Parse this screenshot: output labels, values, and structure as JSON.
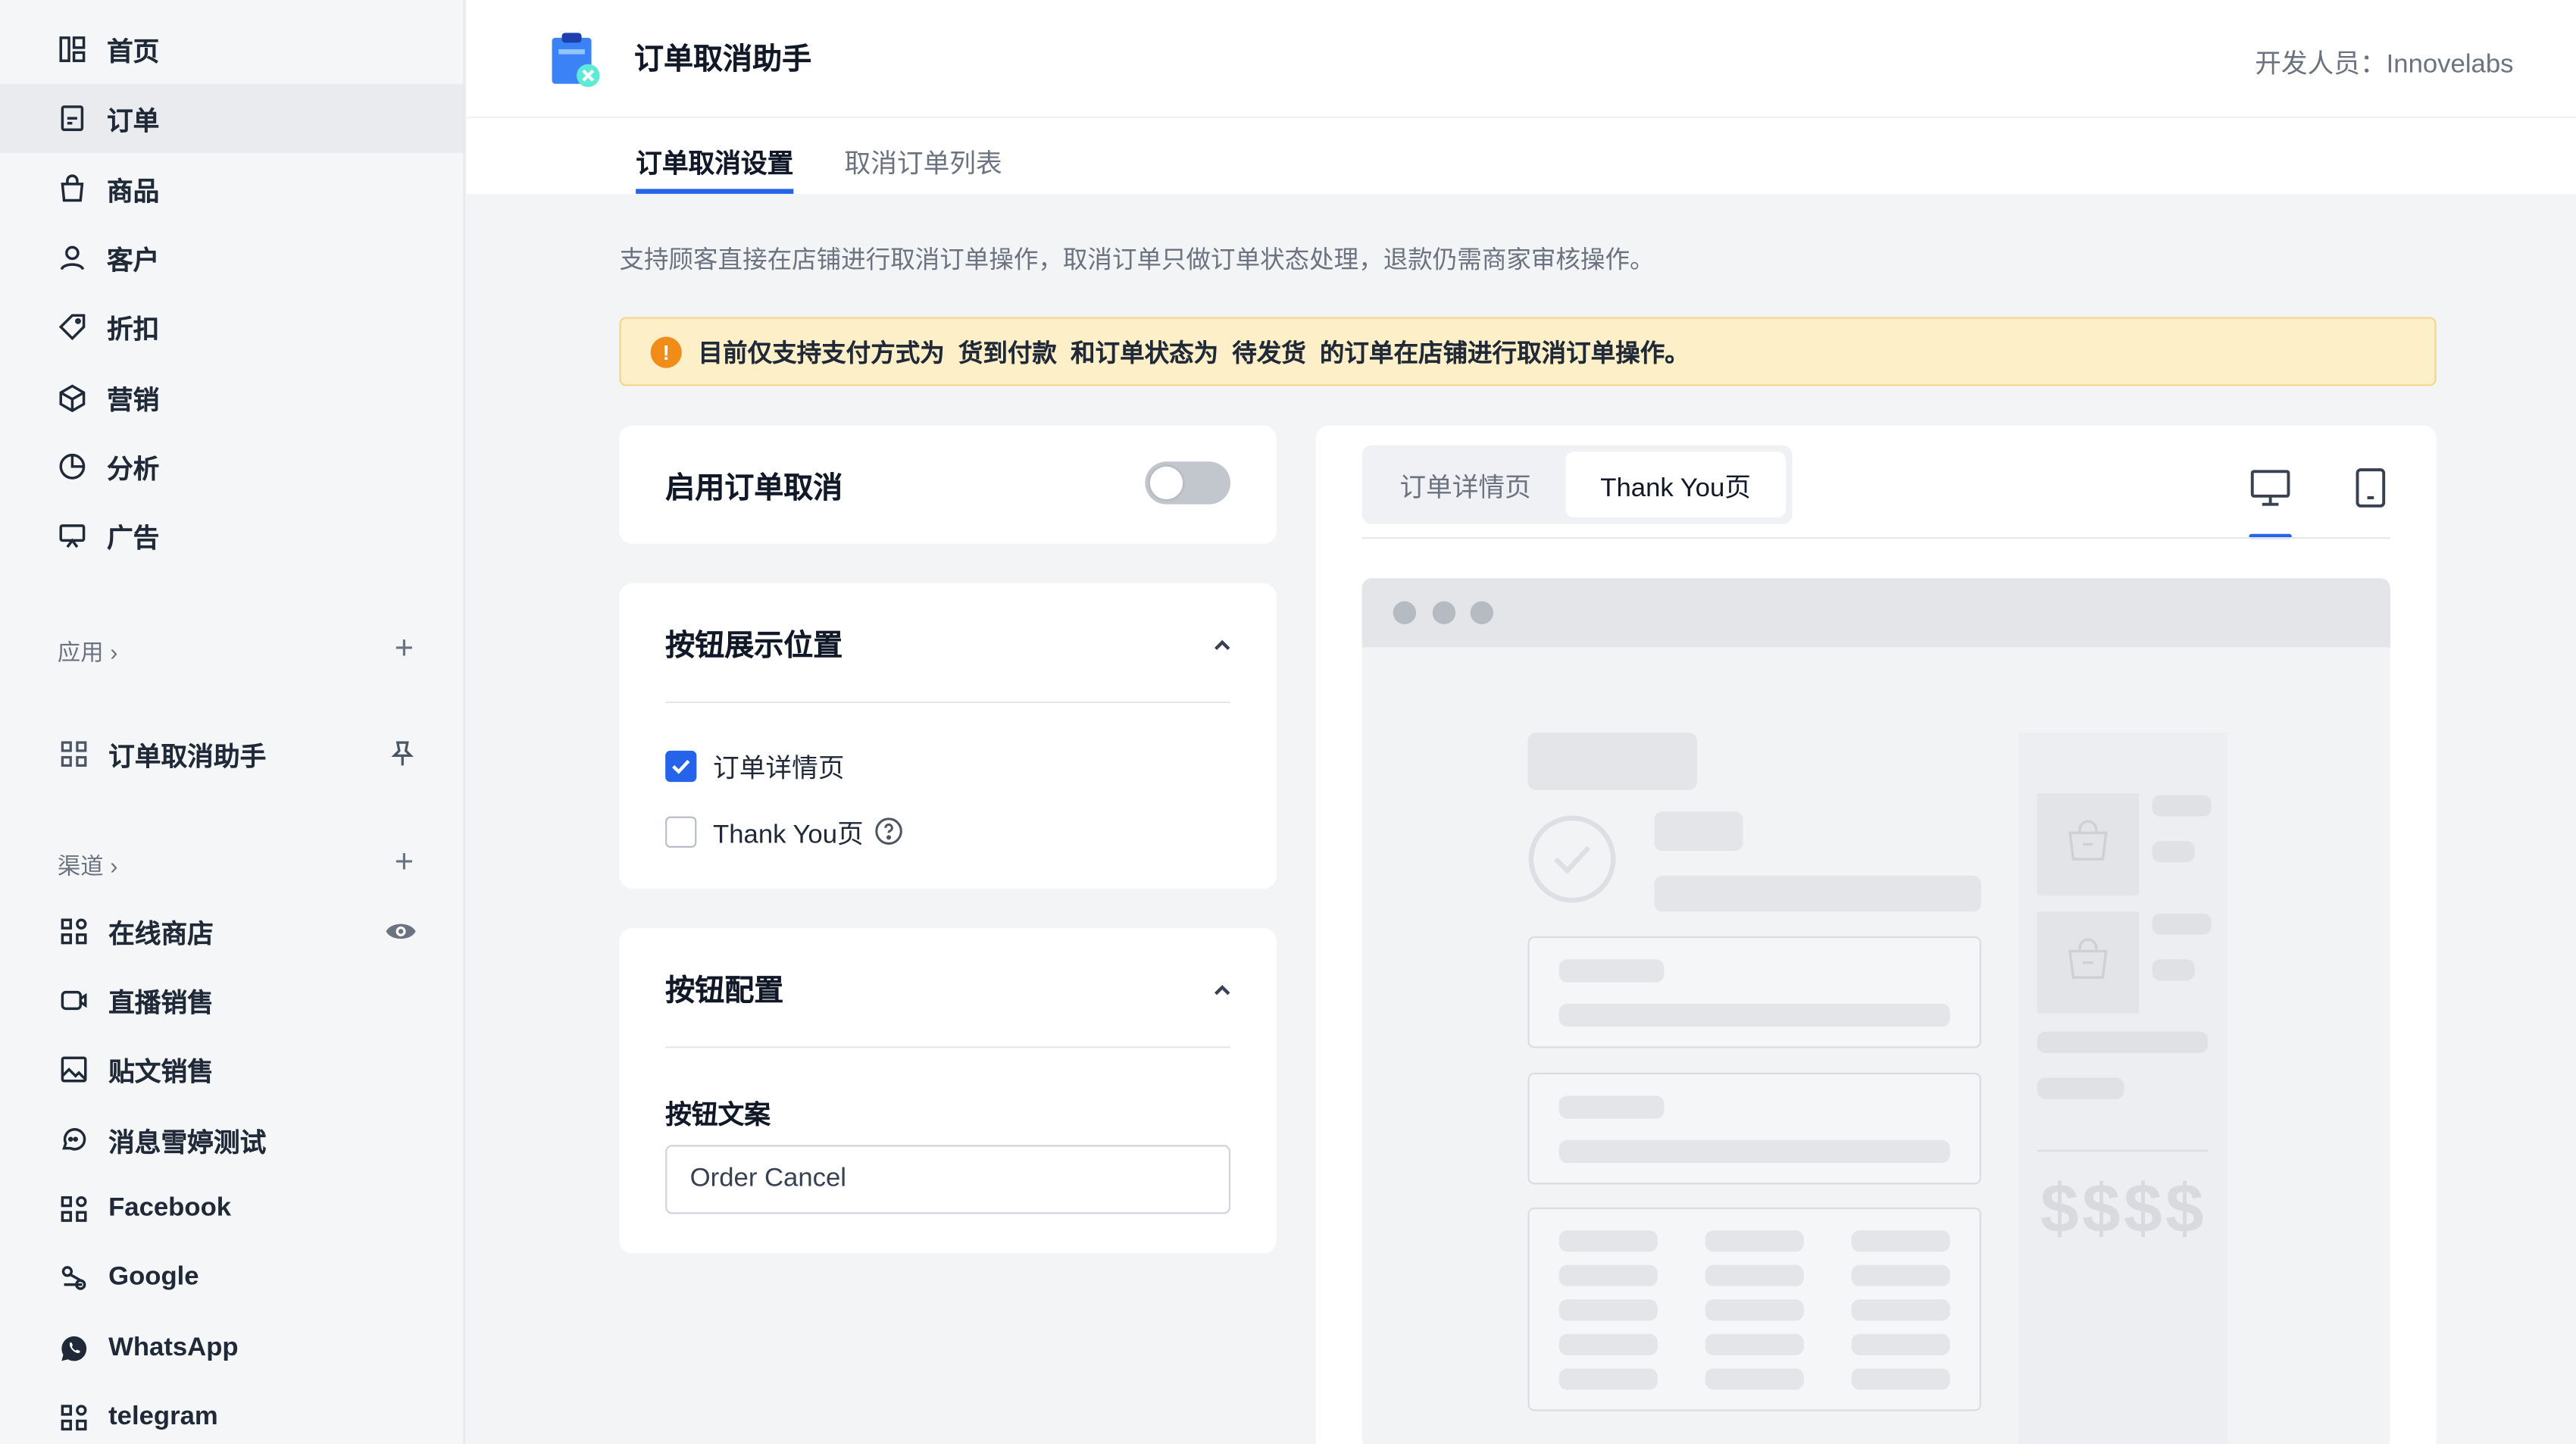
{
  "sidebar": {
    "nav": [
      {
        "label": "首页",
        "icon": "dashboard-icon"
      },
      {
        "label": "订单",
        "icon": "order-icon",
        "active": true
      },
      {
        "label": "商品",
        "icon": "bag-icon"
      },
      {
        "label": "客户",
        "icon": "user-icon"
      },
      {
        "label": "折扣",
        "icon": "tag-icon"
      },
      {
        "label": "营销",
        "icon": "cube-icon"
      },
      {
        "label": "分析",
        "icon": "pie-icon"
      },
      {
        "label": "广告",
        "icon": "ad-icon"
      }
    ],
    "apps_label": "应用",
    "app_item": "订单取消助手",
    "channels_label": "渠道",
    "channels": [
      "在线商店",
      "直播销售",
      "贴文销售",
      "消息雪婷测试",
      "Facebook",
      "Google",
      "WhatsApp",
      "telegram"
    ]
  },
  "header": {
    "title": "订单取消助手",
    "developer": "开发人员：Innovelabs"
  },
  "tabs": [
    "订单取消设置",
    "取消订单列表"
  ],
  "description": "支持顾客直接在店铺进行取消订单操作，取消订单只做订单状态处理，退款仍需商家审核操作。",
  "alert": "目前仅支持支付方式为  货到付款  和订单状态为  待发货  的订单在店铺进行取消订单操作。",
  "enable_card": {
    "title": "启用订单取消",
    "enabled": false
  },
  "position_card": {
    "title": "按钮展示位置",
    "options": [
      {
        "label": "订单详情页",
        "checked": true
      },
      {
        "label": "Thank You页",
        "checked": false
      }
    ]
  },
  "config_card": {
    "title": "按钮配置",
    "field_label": "按钮文案",
    "field_value": "Order Cancel"
  },
  "preview": {
    "tabs": [
      "订单详情页",
      "Thank You页"
    ],
    "active_tab": 1,
    "price_text": "$$$$",
    "device": "desktop"
  },
  "colors": {
    "accent": "#2563eb",
    "alert_bg": "#fdefc8",
    "alert_icon": "#f28c18"
  }
}
